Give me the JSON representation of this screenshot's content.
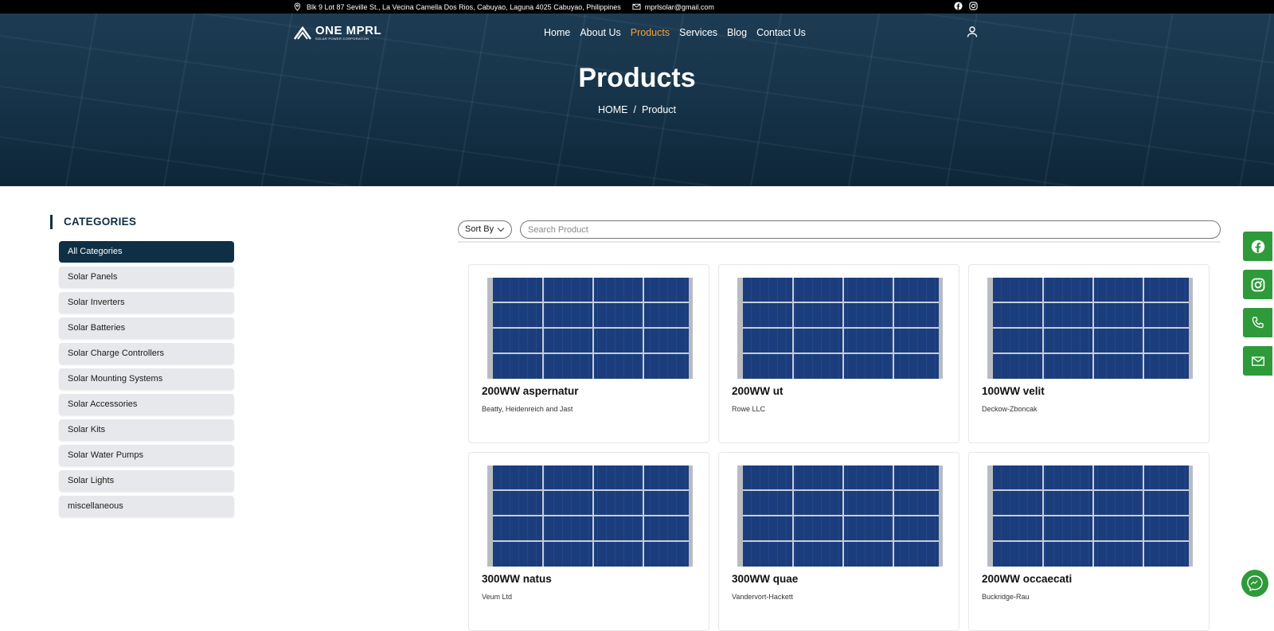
{
  "topbar": {
    "address": "Blk 9 Lot 87 Seville St., La Vecina Camella Dos Rios, Cabuyao, Laguna 4025 Cabuyao, Philippines",
    "email": "mprlsolar@gmail.com",
    "social_icons": [
      "facebook-icon",
      "instagram-icon"
    ]
  },
  "logo": {
    "name": "ONE MPRL",
    "tagline": "SOLAR POWER CORPORATION"
  },
  "nav": {
    "items": [
      {
        "label": "Home"
      },
      {
        "label": "About Us"
      },
      {
        "label": "Products",
        "active": true
      },
      {
        "label": "Services"
      },
      {
        "label": "Blog"
      },
      {
        "label": "Contact Us"
      }
    ],
    "user_icon": "user-icon"
  },
  "hero": {
    "title": "Products",
    "breadcrumb": {
      "home": "HOME",
      "separator": "/",
      "current": "Product"
    }
  },
  "sidebar": {
    "title": "CATEGORIES",
    "items": [
      {
        "label": "All Categories",
        "active": true
      },
      {
        "label": "Solar Panels"
      },
      {
        "label": "Solar Inverters"
      },
      {
        "label": "Solar Batteries"
      },
      {
        "label": "Solar Charge Controllers"
      },
      {
        "label": "Solar Mounting Systems"
      },
      {
        "label": "Solar Accessories"
      },
      {
        "label": "Solar Kits"
      },
      {
        "label": "Solar Water Pumps"
      },
      {
        "label": "Solar Lights"
      },
      {
        "label": "miscellaneous"
      }
    ]
  },
  "toolbar": {
    "sort_label": "Sort By",
    "search_placeholder": "Search Product"
  },
  "products": [
    {
      "name": "200WW aspernatur",
      "brand": "Beatty, Heidenreich and Jast"
    },
    {
      "name": "200WW ut",
      "brand": "Rowe LLC"
    },
    {
      "name": "100WW velit",
      "brand": "Deckow-Zboncak"
    },
    {
      "name": "300WW natus",
      "brand": "Veum Ltd"
    },
    {
      "name": "300WW quae",
      "brand": "Vandervort-Hackett"
    },
    {
      "name": "200WW occaecati",
      "brand": "Buckridge-Rau"
    }
  ],
  "floating_buttons": [
    "facebook-icon",
    "instagram-icon",
    "phone-icon",
    "mail-icon"
  ],
  "colors": {
    "primary": "#0f2f44",
    "accent": "#f2a23a",
    "float_green": "#2e9a3a",
    "panel_blue": "#1b3d7c"
  }
}
